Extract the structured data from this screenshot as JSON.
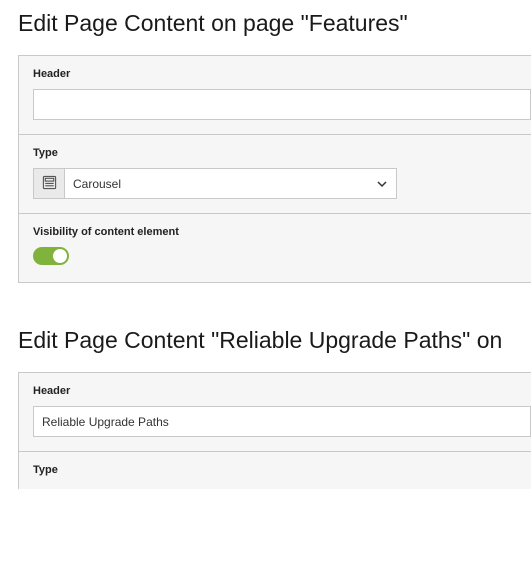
{
  "section1": {
    "title": "Edit Page Content on page \"Features\"",
    "header": {
      "label": "Header",
      "value": ""
    },
    "type": {
      "label": "Type",
      "selected": "Carousel"
    },
    "visibility": {
      "label": "Visibility of content element",
      "on": true
    }
  },
  "section2": {
    "title": "Edit Page Content \"Reliable Upgrade Paths\" on",
    "header": {
      "label": "Header",
      "value": "Reliable Upgrade Paths"
    },
    "type": {
      "label": "Type"
    }
  }
}
